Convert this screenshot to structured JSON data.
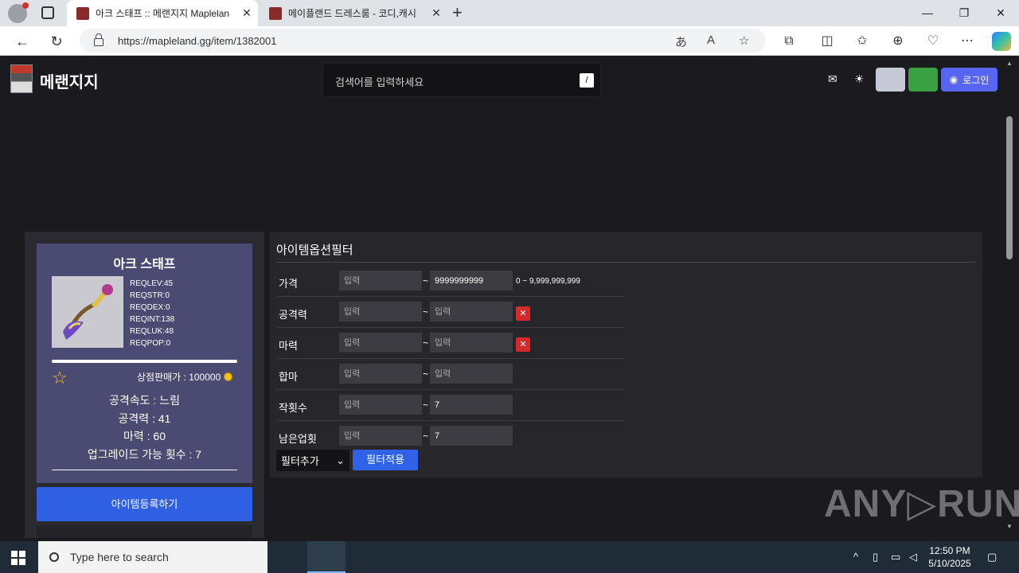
{
  "browser": {
    "tabs": [
      {
        "title": "아크 스태프 :: 메랜지지 Maplelan",
        "active": true
      },
      {
        "title": "메이플랜드 드레스룸 - 코디,캐시",
        "active": false
      }
    ],
    "url": "https://mapleland.gg/item/1382001",
    "icons": [
      "profile-icon",
      "tab-actions-icon",
      "close-icon",
      "new-tab-icon",
      "minimize-icon",
      "maximize-icon",
      "window-close-icon",
      "back-icon",
      "refresh-icon",
      "lock-icon",
      "translate-icon",
      "read-aloud-icon",
      "favorite-icon",
      "extensions-icon",
      "split-screen-icon",
      "favorites-bar-icon",
      "collections-icon",
      "performance-icon",
      "more-icon",
      "copilot-icon"
    ]
  },
  "site": {
    "logo_text": "메랜지지",
    "search_placeholder": "검색어를 입력하세요",
    "search_shortcut": "/",
    "login_label": "로그인"
  },
  "item": {
    "name": "아크 스태프",
    "reqs": [
      "REQLEV:45",
      "REQSTR:0",
      "REQDEX:0",
      "REQINT:138",
      "REQLUK:48",
      "REQPOP:0"
    ],
    "shop_price": "상점판매가 : 100000",
    "stats": [
      "공격속도 : 느림",
      "공격력 : 41",
      "마력 : 60",
      "업그레이드 가능 횟수 : 7"
    ],
    "register_label": "아이템등록하기"
  },
  "filter": {
    "title": "아이템옵션필터",
    "placeholder": "입력",
    "rows": [
      {
        "label": "가격",
        "min": "",
        "max": "9999999999",
        "hint": "0 ~ 9,999,999,999",
        "removable": false
      },
      {
        "label": "공격력",
        "min": "",
        "max": "",
        "removable": true
      },
      {
        "label": "마력",
        "min": "",
        "max": "",
        "removable": true
      },
      {
        "label": "합마",
        "min": "",
        "max": "",
        "removable": false
      },
      {
        "label": "작횟수",
        "min": "",
        "max": "7",
        "removable": false
      },
      {
        "label": "남은업횟",
        "min": "",
        "max": "7",
        "removable": false
      }
    ],
    "tilde": "~",
    "remove_glyph": "✕",
    "add_select_label": "필터추가",
    "apply_label": "필터적용"
  },
  "watermark": "ANY▷RUN",
  "taskbar": {
    "search_placeholder": "Type here to search",
    "time": "12:50 PM",
    "date": "5/10/2025"
  }
}
